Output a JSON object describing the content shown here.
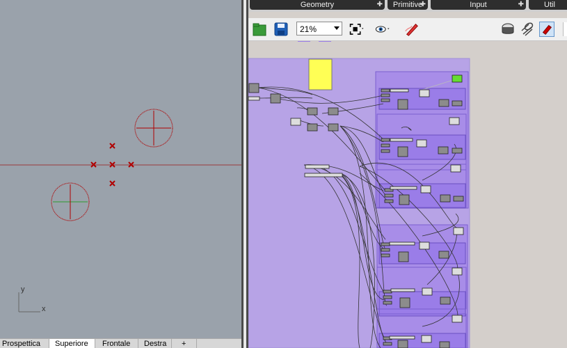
{
  "viewport_tabs": [
    "Prospettica",
    "Superiore",
    "Frontale",
    "Destra"
  ],
  "viewport_active_tab": "Superiore",
  "add_tab_symbol": "+",
  "axis_labels": {
    "x": "x",
    "y": "y"
  },
  "gh_tabs": [
    "Geometry",
    "Primitive",
    "Input",
    "Util"
  ],
  "zoom": "21%",
  "icons": [
    "open-file-icon",
    "save-file-icon",
    "zoom-extents-icon",
    "preview-eye-icon",
    "sketch-pen-icon",
    "preview-shaded-icon",
    "preview-wire-icon",
    "preview-selected-icon"
  ],
  "colors": {
    "viewport_bg": "#9aa2ab",
    "axis_x": "#9b3b3b",
    "axis_y": "#2f9a2f",
    "curve_red": "#b00000",
    "group_bg": "#b7a3e6",
    "cluster_bg": "#9a7de8",
    "panel_yellow": "#ffff55",
    "toggle_green": "#66dd33"
  }
}
